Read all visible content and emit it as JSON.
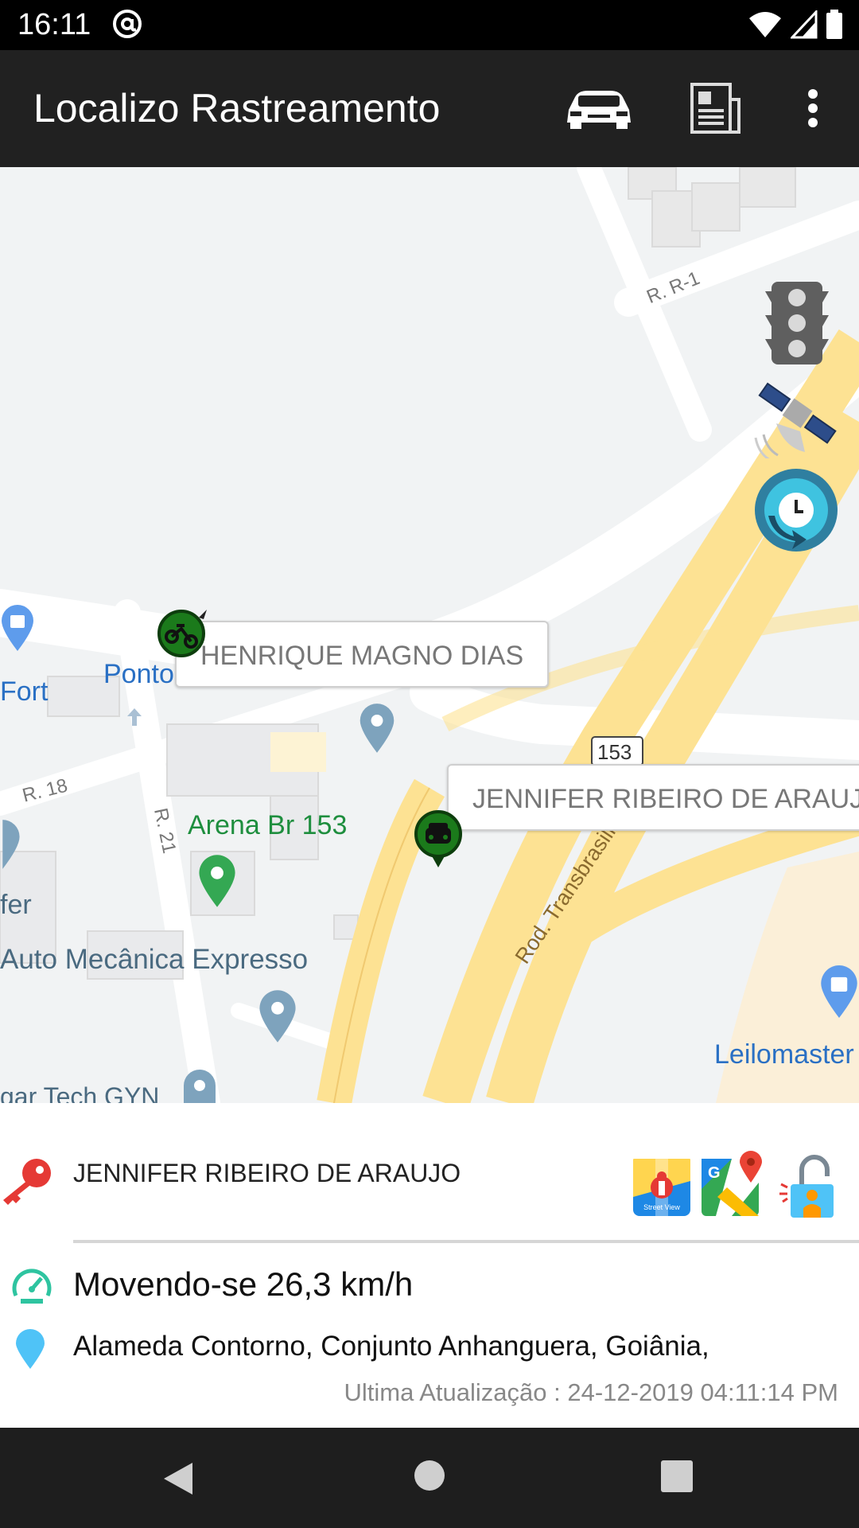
{
  "status_bar": {
    "time": "16:11"
  },
  "app_bar": {
    "title": "Localizo Rastreamento"
  },
  "map": {
    "street_labels": {
      "r_r1": "R. R-1",
      "r_18": "R. 18",
      "r_21": "R. 21",
      "route_badge": "153",
      "rod_transbrasiliana": "Rod. Transbrasiliana"
    },
    "poi_labels": {
      "fort": "Fort",
      "ponto": "Ponto",
      "arena": "Arena Br 153",
      "auto_mecanica": "Auto Mecânica Expresso",
      "tech_gyn": "gar Tech GYN",
      "leilomaster": "Leilomaster",
      "fer": "fer"
    },
    "vehicles": [
      {
        "name": "HENRIQUE MAGNO DIAS",
        "type": "motorcycle"
      },
      {
        "name": "JENNIFER RIBEIRO DE ARAUJO",
        "type": "car"
      }
    ],
    "controls": [
      "traffic-light-icon",
      "satellite-icon",
      "history-clock-icon"
    ]
  },
  "info_panel": {
    "vehicle_name": "JENNIFER RIBEIRO DE ARAUJO",
    "speed_status": "Movendo-se 26,3 km/h",
    "address": "Alameda Contorno, Conjunto Anhanguera, Goiânia,",
    "last_update": "Ultima Atualização : 24-12-2019 04:11:14 PM",
    "street_view_label": "Street View",
    "actions": [
      "street-view-icon",
      "google-maps-icon",
      "unlock-icon"
    ]
  },
  "colors": {
    "app_bar": "#212121",
    "status_bar": "#000000",
    "nav_bar": "#1e1e1e",
    "road_major": "#fde293",
    "poi_green": "#1e8e3e",
    "poi_blue": "#1a73e8",
    "speed_icon": "#2ec4a0",
    "key_icon": "#e53935",
    "location_icon": "#4fc3f7"
  }
}
